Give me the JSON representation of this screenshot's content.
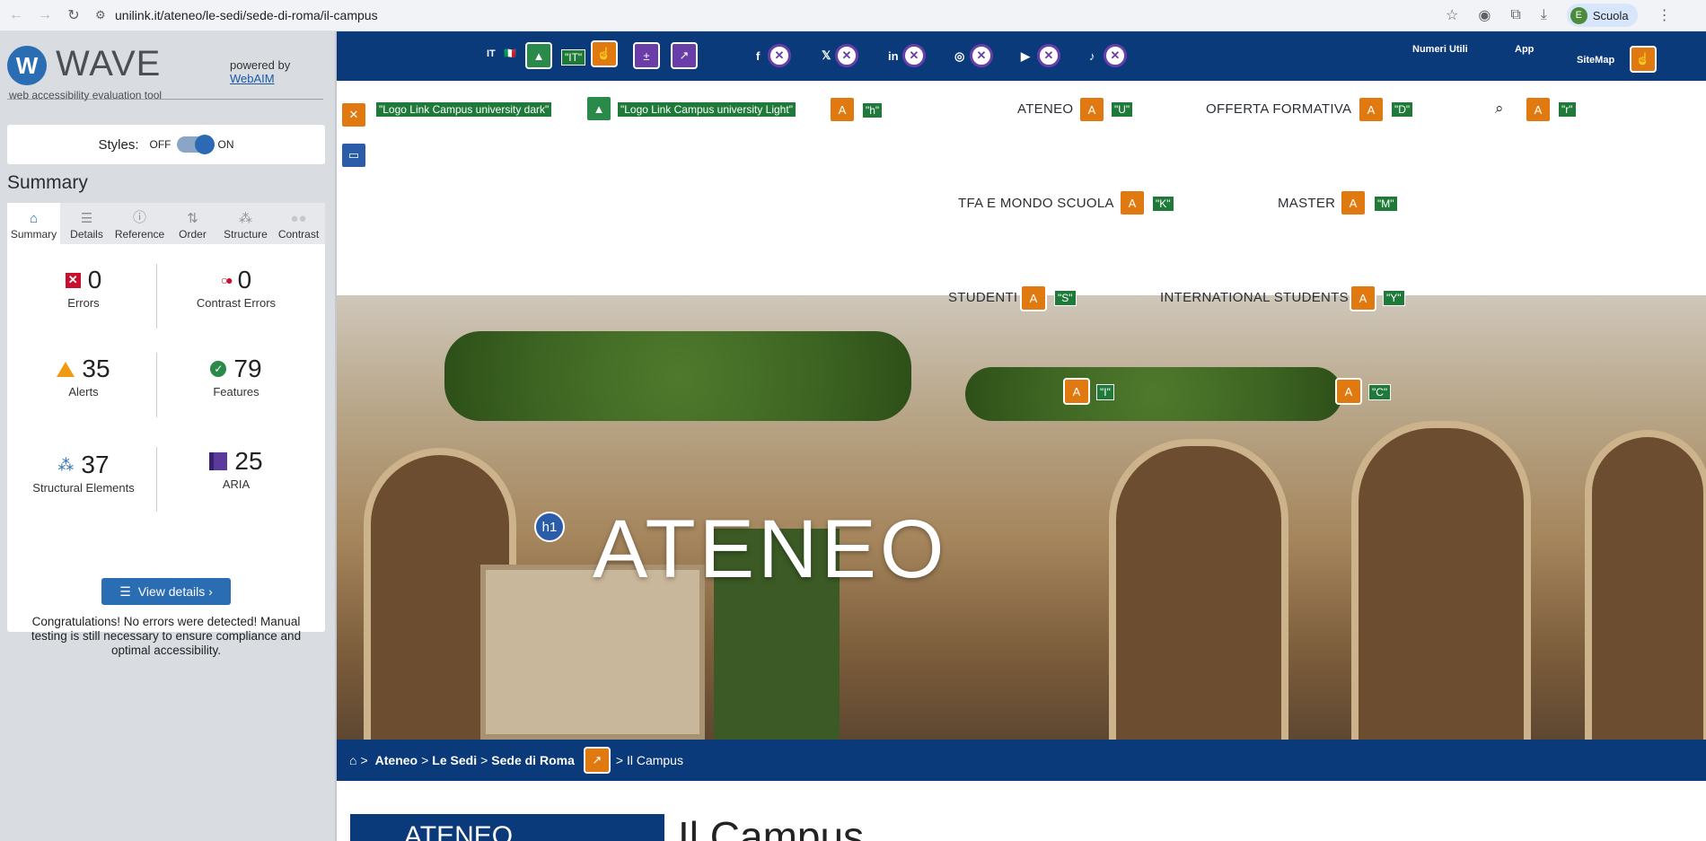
{
  "browser": {
    "url": "unilink.it/ateneo/le-sedi/sede-di-roma/il-campus",
    "profile_initial": "E",
    "profile_name": "Scuola"
  },
  "wave": {
    "name": "WAVE",
    "subtitle": "web accessibility evaluation tool",
    "powered_by": "powered by",
    "webaim": "WebAIM",
    "styles_label": "Styles:",
    "off": "OFF",
    "on": "ON",
    "summary_title": "Summary",
    "tabs": [
      {
        "label": "Summary",
        "icon": "home-icon"
      },
      {
        "label": "Details",
        "icon": "list-icon"
      },
      {
        "label": "Reference",
        "icon": "info-icon"
      },
      {
        "label": "Order",
        "icon": "order-icon"
      },
      {
        "label": "Structure",
        "icon": "structure-icon"
      },
      {
        "label": "Contrast",
        "icon": "contrast-icon"
      }
    ],
    "stats": {
      "errors": {
        "value": "0",
        "label": "Errors"
      },
      "contrast": {
        "value": "0",
        "label": "Contrast Errors"
      },
      "alerts": {
        "value": "35",
        "label": "Alerts"
      },
      "features": {
        "value": "79",
        "label": "Features"
      },
      "structural": {
        "value": "37",
        "label": "Structural Elements"
      },
      "aria": {
        "value": "25",
        "label": "ARIA"
      }
    },
    "view_details": "View details ›",
    "congrats": "Congratulations! No errors were detected! Manual testing is still necessary to ensure compliance and optimal accessibility."
  },
  "site": {
    "lang": "IT",
    "top_links": {
      "numeri": "Numeri Utili",
      "app": "App",
      "sitemap": "SiteMap"
    },
    "tags": {
      "it": "\"IT\"",
      "logo_dark": "\"Logo Link Campus university dark\"",
      "logo_light": "\"Logo Link Campus university Light\"",
      "h": "\"h\"",
      "u": "\"U\"",
      "d": "\"D\"",
      "r": "\"r\"",
      "k": "\"K\"",
      "m": "\"M\"",
      "s": "\"S\"",
      "y": "\"Y\"",
      "i": "\"I\"",
      "c": "\"C\""
    },
    "menu": {
      "ateneo": "ATENEO",
      "offerta": "OFFERTA FORMATIVA",
      "tfa": "TFA E MONDO SCUOLA",
      "master": "MASTER",
      "studenti": "STUDENTI",
      "international": "INTERNATIONAL STUDENTS"
    },
    "hero_title": "ATENEO",
    "h1_badge": "h1",
    "breadcrumb": {
      "sep": ">",
      "ateneo": "Ateneo",
      "sedi": "Le Sedi",
      "roma": "Sede di Roma",
      "current": "> Il Campus"
    },
    "side_box": "ATENEO",
    "page_heading": "Il Campus"
  }
}
